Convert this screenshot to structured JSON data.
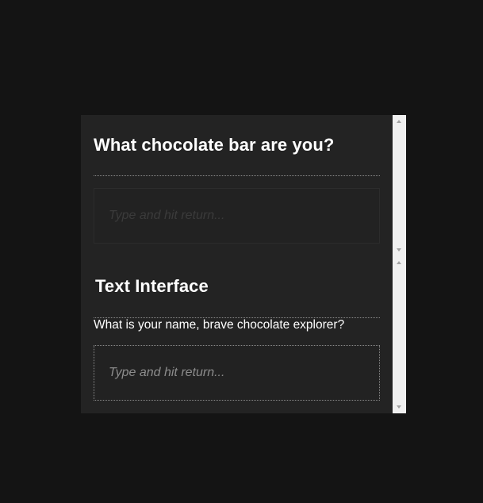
{
  "top_panel": {
    "title": "What chocolate bar are you?",
    "input_placeholder": "Type and hit return..."
  },
  "bottom_panel": {
    "title": "Text Interface",
    "prompt": "What is your name, brave chocolate explorer?",
    "input_placeholder": "Type and hit return..."
  },
  "colors": {
    "page_background": "#141414",
    "panel_background": "#232323",
    "text": "#ffffff",
    "placeholder": "#8c8c8c",
    "scrollbar": "#f0f0f0"
  },
  "icons": {
    "scroll_up": "scroll-up-arrow-icon",
    "scroll_down": "scroll-down-arrow-icon"
  }
}
